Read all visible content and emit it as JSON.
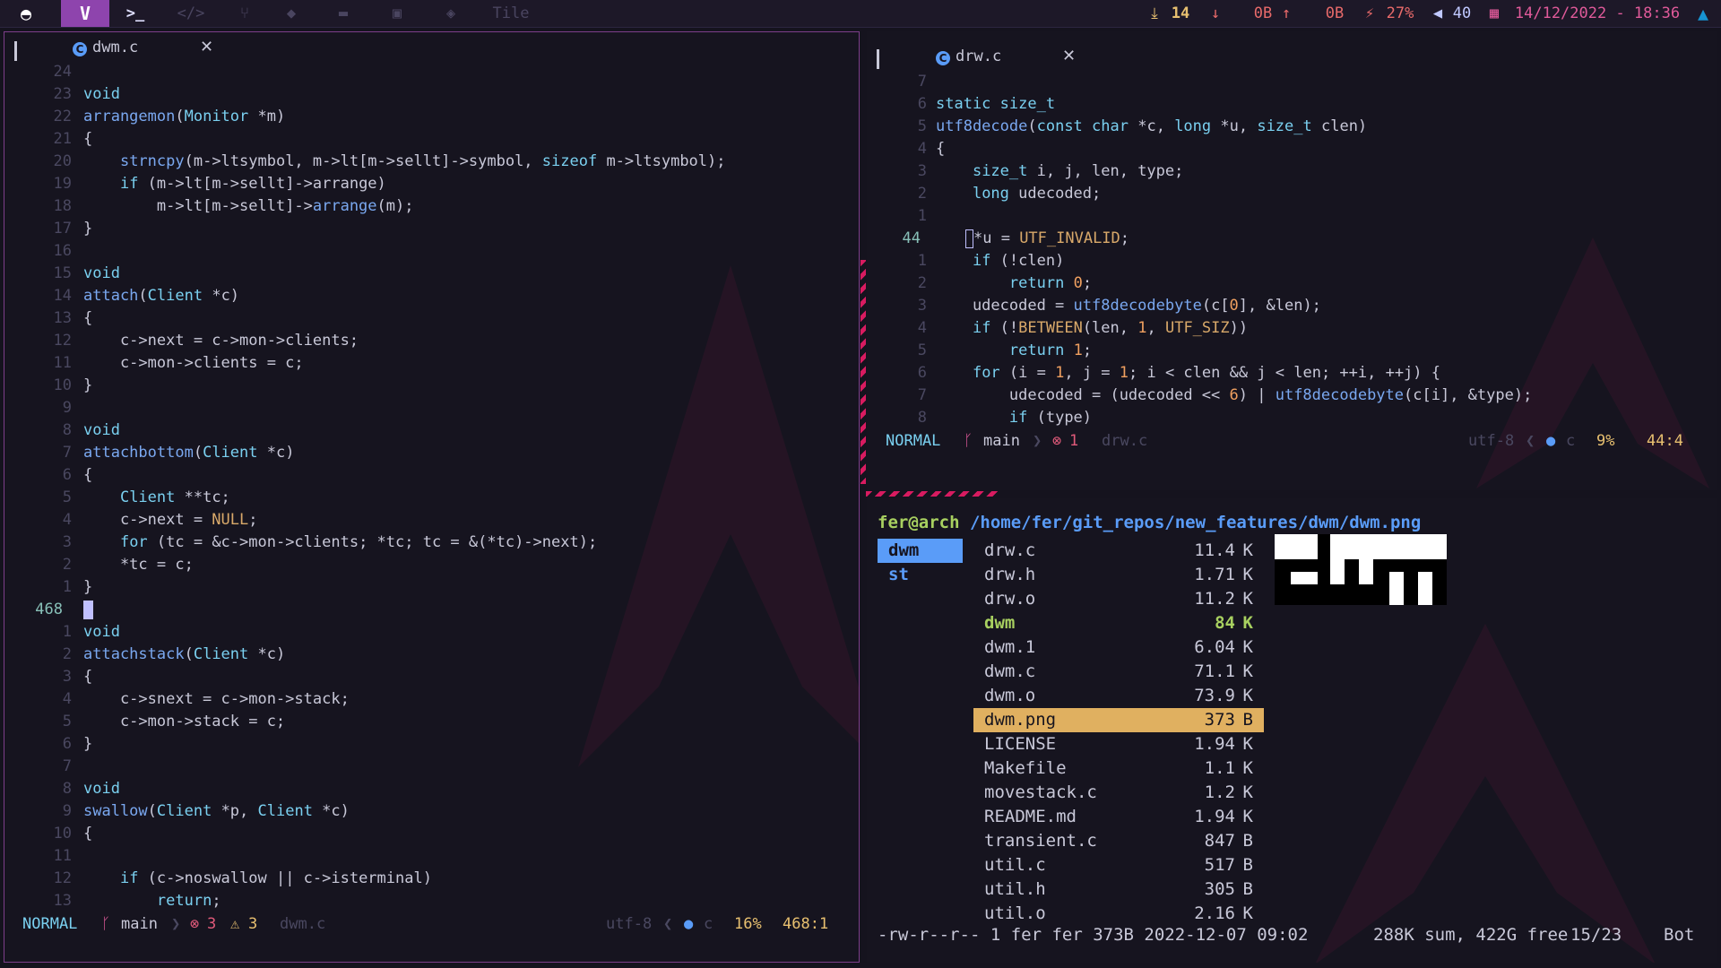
{
  "topbar": {
    "tags": [
      "terminal",
      "code",
      "git",
      "gamepad",
      "folder",
      "image",
      "layers"
    ],
    "layout": "Tile",
    "updates": "14",
    "net_down": "0B",
    "net_up": "0B",
    "battery": "27%",
    "volume": "40",
    "datetime": "14/12/2022 - 18:36"
  },
  "left_editor": {
    "filename": "dwm.c",
    "close": "✕",
    "lines": [
      {
        "n": "24",
        "t": ""
      },
      {
        "n": "23",
        "t": "void"
      },
      {
        "n": "22",
        "t": "arrangemon(Monitor *m)"
      },
      {
        "n": "21",
        "t": "{"
      },
      {
        "n": "20",
        "t": "    strncpy(m->ltsymbol, m->lt[m->sellt]->symbol, sizeof m->ltsymbol);"
      },
      {
        "n": "19",
        "t": "    if (m->lt[m->sellt]->arrange)"
      },
      {
        "n": "18",
        "t": "        m->lt[m->sellt]->arrange(m);"
      },
      {
        "n": "17",
        "t": "}"
      },
      {
        "n": "16",
        "t": ""
      },
      {
        "n": "15",
        "t": "void"
      },
      {
        "n": "14",
        "t": "attach(Client *c)"
      },
      {
        "n": "13",
        "t": "{"
      },
      {
        "n": "12",
        "t": "    c->next = c->mon->clients;"
      },
      {
        "n": "11",
        "t": "    c->mon->clients = c;"
      },
      {
        "n": "10",
        "t": "}"
      },
      {
        "n": "9",
        "t": ""
      },
      {
        "n": "8",
        "t": "void"
      },
      {
        "n": "7",
        "t": "attachbottom(Client *c)"
      },
      {
        "n": "6",
        "t": "{"
      },
      {
        "n": "5",
        "t": "    Client **tc;"
      },
      {
        "n": "4",
        "t": "    c->next = NULL;"
      },
      {
        "n": "3",
        "t": "    for (tc = &c->mon->clients; *tc; tc = &(*tc)->next);"
      },
      {
        "n": "2",
        "t": "    *tc = c;"
      },
      {
        "n": "1",
        "t": "}"
      },
      {
        "n": "468",
        "t": ""
      },
      {
        "n": "1",
        "t": "void"
      },
      {
        "n": "2",
        "t": "attachstack(Client *c)"
      },
      {
        "n": "3",
        "t": "{"
      },
      {
        "n": "4",
        "t": "    c->snext = c->mon->stack;"
      },
      {
        "n": "5",
        "t": "    c->mon->stack = c;"
      },
      {
        "n": "6",
        "t": "}"
      },
      {
        "n": "7",
        "t": ""
      },
      {
        "n": "8",
        "t": "void"
      },
      {
        "n": "9",
        "t": "swallow(Client *p, Client *c)"
      },
      {
        "n": "10",
        "t": "{"
      },
      {
        "n": "11",
        "t": ""
      },
      {
        "n": "12",
        "t": "    if (c->noswallow || c->isterminal)"
      },
      {
        "n": "13",
        "t": "        return;"
      }
    ],
    "status": {
      "mode": "NORMAL",
      "branch": "main",
      "errors": "3",
      "warnings": "3",
      "file": "dwm.c",
      "encoding": "utf-8",
      "filetype": "c",
      "percent": "16%",
      "position": "468:1"
    }
  },
  "right_editor": {
    "filename": "drw.c",
    "close": "✕",
    "lines": [
      {
        "n": "7",
        "t": ""
      },
      {
        "n": "6",
        "t": "static size_t"
      },
      {
        "n": "5",
        "t": "utf8decode(const char *c, long *u, size_t clen)"
      },
      {
        "n": "4",
        "t": "{"
      },
      {
        "n": "3",
        "t": "    size_t i, j, len, type;"
      },
      {
        "n": "2",
        "t": "    long udecoded;"
      },
      {
        "n": "1",
        "t": ""
      },
      {
        "n": "44",
        "t": "*u = UTF_INVALID;"
      },
      {
        "n": "1",
        "t": "    if (!clen)"
      },
      {
        "n": "2",
        "t": "        return 0;"
      },
      {
        "n": "3",
        "t": "    udecoded = utf8decodebyte(c[0], &len);"
      },
      {
        "n": "4",
        "t": "    if (!BETWEEN(len, 1, UTF_SIZ))"
      },
      {
        "n": "5",
        "t": "        return 1;"
      },
      {
        "n": "6",
        "t": "    for (i = 1, j = 1; i < clen && j < len; ++i, ++j) {"
      },
      {
        "n": "7",
        "t": "        udecoded = (udecoded << 6) | utf8decodebyte(c[i], &type);"
      },
      {
        "n": "8",
        "t": "        if (type)"
      }
    ],
    "status": {
      "mode": "NORMAL",
      "branch": "main",
      "errors": "1",
      "file": "drw.c",
      "encoding": "utf-8",
      "filetype": "c",
      "percent": "9%",
      "position": "44:4"
    }
  },
  "file_manager": {
    "user": "fer@arch",
    "path": "/home/fer/git_repos/new_features/dwm/dwm.png",
    "dirs": [
      "dwm",
      "st"
    ],
    "files": [
      {
        "name": "drw.c",
        "size": "11.4",
        "unit": "K"
      },
      {
        "name": "drw.h",
        "size": "1.71",
        "unit": "K"
      },
      {
        "name": "drw.o",
        "size": "11.2",
        "unit": "K"
      },
      {
        "name": "dwm",
        "size": "84",
        "unit": "K"
      },
      {
        "name": "dwm.1",
        "size": "6.04",
        "unit": "K"
      },
      {
        "name": "dwm.c",
        "size": "71.1",
        "unit": "K"
      },
      {
        "name": "dwm.o",
        "size": "73.9",
        "unit": "K"
      },
      {
        "name": "dwm.png",
        "size": "373",
        "unit": "B"
      },
      {
        "name": "LICENSE",
        "size": "1.94",
        "unit": "K"
      },
      {
        "name": "Makefile",
        "size": "1.1",
        "unit": "K"
      },
      {
        "name": "movestack.c",
        "size": "1.2",
        "unit": "K"
      },
      {
        "name": "README.md",
        "size": "1.94",
        "unit": "K"
      },
      {
        "name": "transient.c",
        "size": "847",
        "unit": "B"
      },
      {
        "name": "util.c",
        "size": "517",
        "unit": "B"
      },
      {
        "name": "util.h",
        "size": "305",
        "unit": "B"
      },
      {
        "name": "util.o",
        "size": "2.16",
        "unit": "K"
      }
    ],
    "footer": {
      "perms": "-rw-r--r-- 1 fer fer 373B 2022-12-07 09:02",
      "summary": "288K sum, 422G free",
      "count": "15/23",
      "scroll": "Bot"
    }
  },
  "colors": {
    "accent": "#8e44ad",
    "border": "#7d3f8a",
    "stripe": "#d81b60",
    "selection": "#e0b060",
    "dir": "#5a9cf8"
  }
}
